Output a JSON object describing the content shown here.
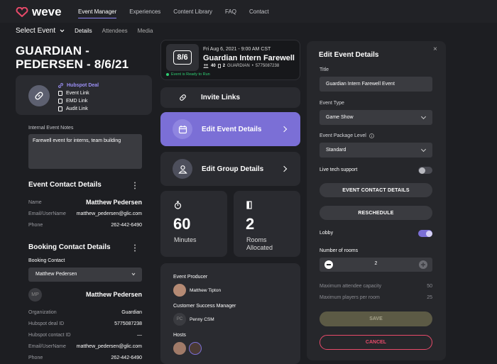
{
  "brand": {
    "name": "weve"
  },
  "nav": {
    "items": [
      "Event Manager",
      "Experiences",
      "Content Library",
      "FAQ",
      "Contact"
    ],
    "active_color": "#8d84f4"
  },
  "subnav": {
    "select_label": "Select Event",
    "tabs": [
      "Details",
      "Attendees",
      "Media"
    ]
  },
  "event": {
    "title": "GUARDIAN - PEDERSEN - 8/6/21",
    "date_badge": "8/6",
    "datetime": "Fri Aug 6, 2021 - 9:00 AM CST",
    "name": "Guardian Intern Farewell",
    "attendees": "40",
    "rooms_small": "2",
    "org_code": "GUARDIAN",
    "id_code": "5775087238",
    "status": "Event is Ready to Run",
    "status_color": "#2ecc71"
  },
  "links": {
    "hubspot": "Hubspot Deal",
    "items": [
      "Event Link",
      "EMD Link",
      "Audit Link"
    ]
  },
  "notes": {
    "label": "Internal Event Notes",
    "text": "Farewell event for interns, team building"
  },
  "event_contact": {
    "heading": "Event Contact Details",
    "name_label": "Name",
    "name": "Matthew Pedersen",
    "email_label": "Email/UserName",
    "email": "matthew_pedersen@glic.com",
    "phone_label": "Phone",
    "phone": "262-442-6490"
  },
  "booking_contact": {
    "heading": "Booking Contact Details",
    "select_label": "Booking Contact",
    "select_value": "Matthew Pedersen",
    "initials": "MP",
    "name": "Matthew Pedersen",
    "org_label": "Organization",
    "org": "Guardian",
    "deal_label": "Hubspot deal ID",
    "deal": "5775087238",
    "contact_label": "Hubspot contact ID",
    "contact": "—",
    "email_label": "Email/UserName",
    "email": "matthew_pedersen@glic.com",
    "phone_label": "Phone",
    "phone": "262-442-6490"
  },
  "mid": {
    "invite": "Invite Links",
    "edit_event": "Edit Event Details",
    "edit_group": "Edit Group Details",
    "accent": "#7b6fd6",
    "minutes_value": "60",
    "minutes_label": "Minutes",
    "rooms_value": "2",
    "rooms_label": "Rooms Allocated",
    "producer_label": "Event Producer",
    "producer": "Matthew Tipton",
    "csm_label": "Customer Success Manager",
    "csm_initials": "PC",
    "csm": "Penny CSM",
    "hosts_label": "Hosts"
  },
  "panel": {
    "heading": "Edit Event Details",
    "close": "×",
    "title_label": "Title",
    "title_value": "Guardian Intern Farewell Event",
    "type_label": "Event Type",
    "type_value": "Game Show",
    "package_label": "Event Package Level",
    "package_value": "Standard",
    "live_label": "Live tech support",
    "live_on": false,
    "contact_btn": "EVENT CONTACT DETAILS",
    "reschedule_btn": "RESCHEDULE",
    "lobby_label": "Lobby",
    "lobby_on": true,
    "rooms_label": "Number of rooms",
    "rooms_value": "2",
    "cap_label": "Maximum attendee capacity",
    "cap_value": "50",
    "players_label": "Maximum players per room",
    "players_value": "25",
    "save": "SAVE",
    "save_color": "#5c5a45",
    "cancel": "CANCEL",
    "cancel_color": "#e84a6a"
  }
}
